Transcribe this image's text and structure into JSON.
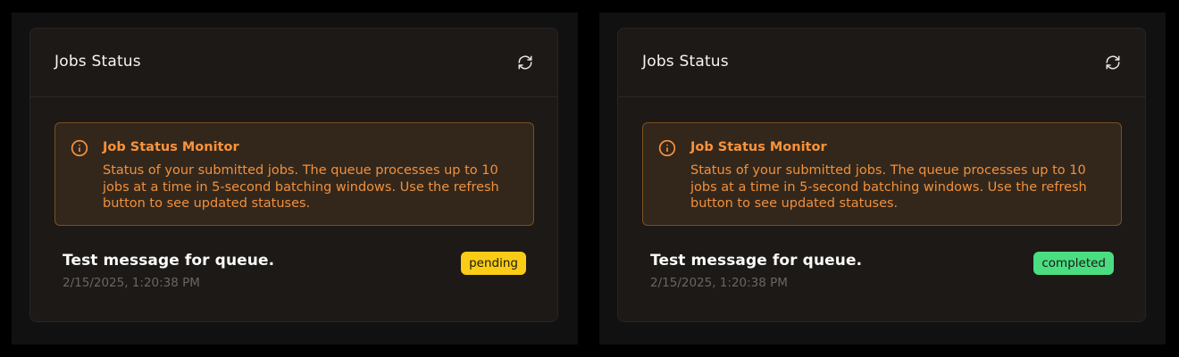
{
  "panels": [
    {
      "card_title": "Jobs Status",
      "alert": {
        "title": "Job Status Monitor",
        "text": "Status of your submitted jobs. The queue processes up to 10 jobs at a time in 5-second batching windows. Use the refresh button to see updated statuses."
      },
      "job": {
        "message": "Test message for queue.",
        "timestamp": "2/15/2025, 1:20:38 PM",
        "status": "pending"
      }
    },
    {
      "card_title": "Jobs Status",
      "alert": {
        "title": "Job Status Monitor",
        "text": "Status of your submitted jobs. The queue processes up to 10 jobs at a time in 5-second batching windows. Use the refresh button to see updated statuses."
      },
      "job": {
        "message": "Test message for queue.",
        "timestamp": "2/15/2025, 1:20:38 PM",
        "status": "completed"
      }
    }
  ],
  "icons": {
    "refresh": "refresh-icon",
    "info": "info-icon"
  },
  "colors": {
    "accent_orange": "#fb923c",
    "pending": "#facc15",
    "completed": "#4ade80",
    "card_bg": "#1c1917"
  }
}
